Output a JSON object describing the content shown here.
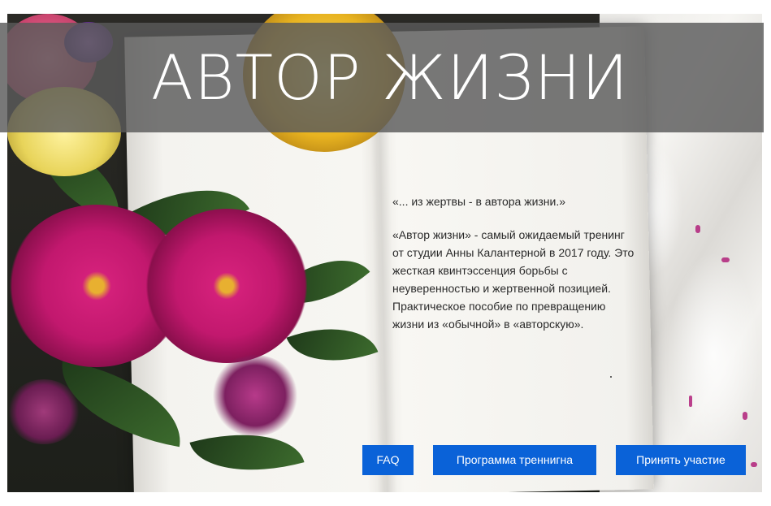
{
  "hero": {
    "title": "АВТОР ЖИЗНИ",
    "quote": "«... из жертвы - в автора жизни.»",
    "description": "«Автор жизни» - самый ожидаемый тренинг от студии Анны Калантерной в 2017 году. Это жесткая квинтэссенция борьбы с неуверенностью и жертвенной позицией. Практическое пособие по превращению жизни из «обычной» в «авторскую».",
    "colors": {
      "title_band": "#5a5a5a",
      "button": "#0a62d8",
      "flower_magenta": "#c2186e",
      "flower_yellow": "#e8c22a"
    }
  },
  "buttons": {
    "faq": "FAQ",
    "program": "Программа треннигна",
    "join": "Принять участие"
  }
}
